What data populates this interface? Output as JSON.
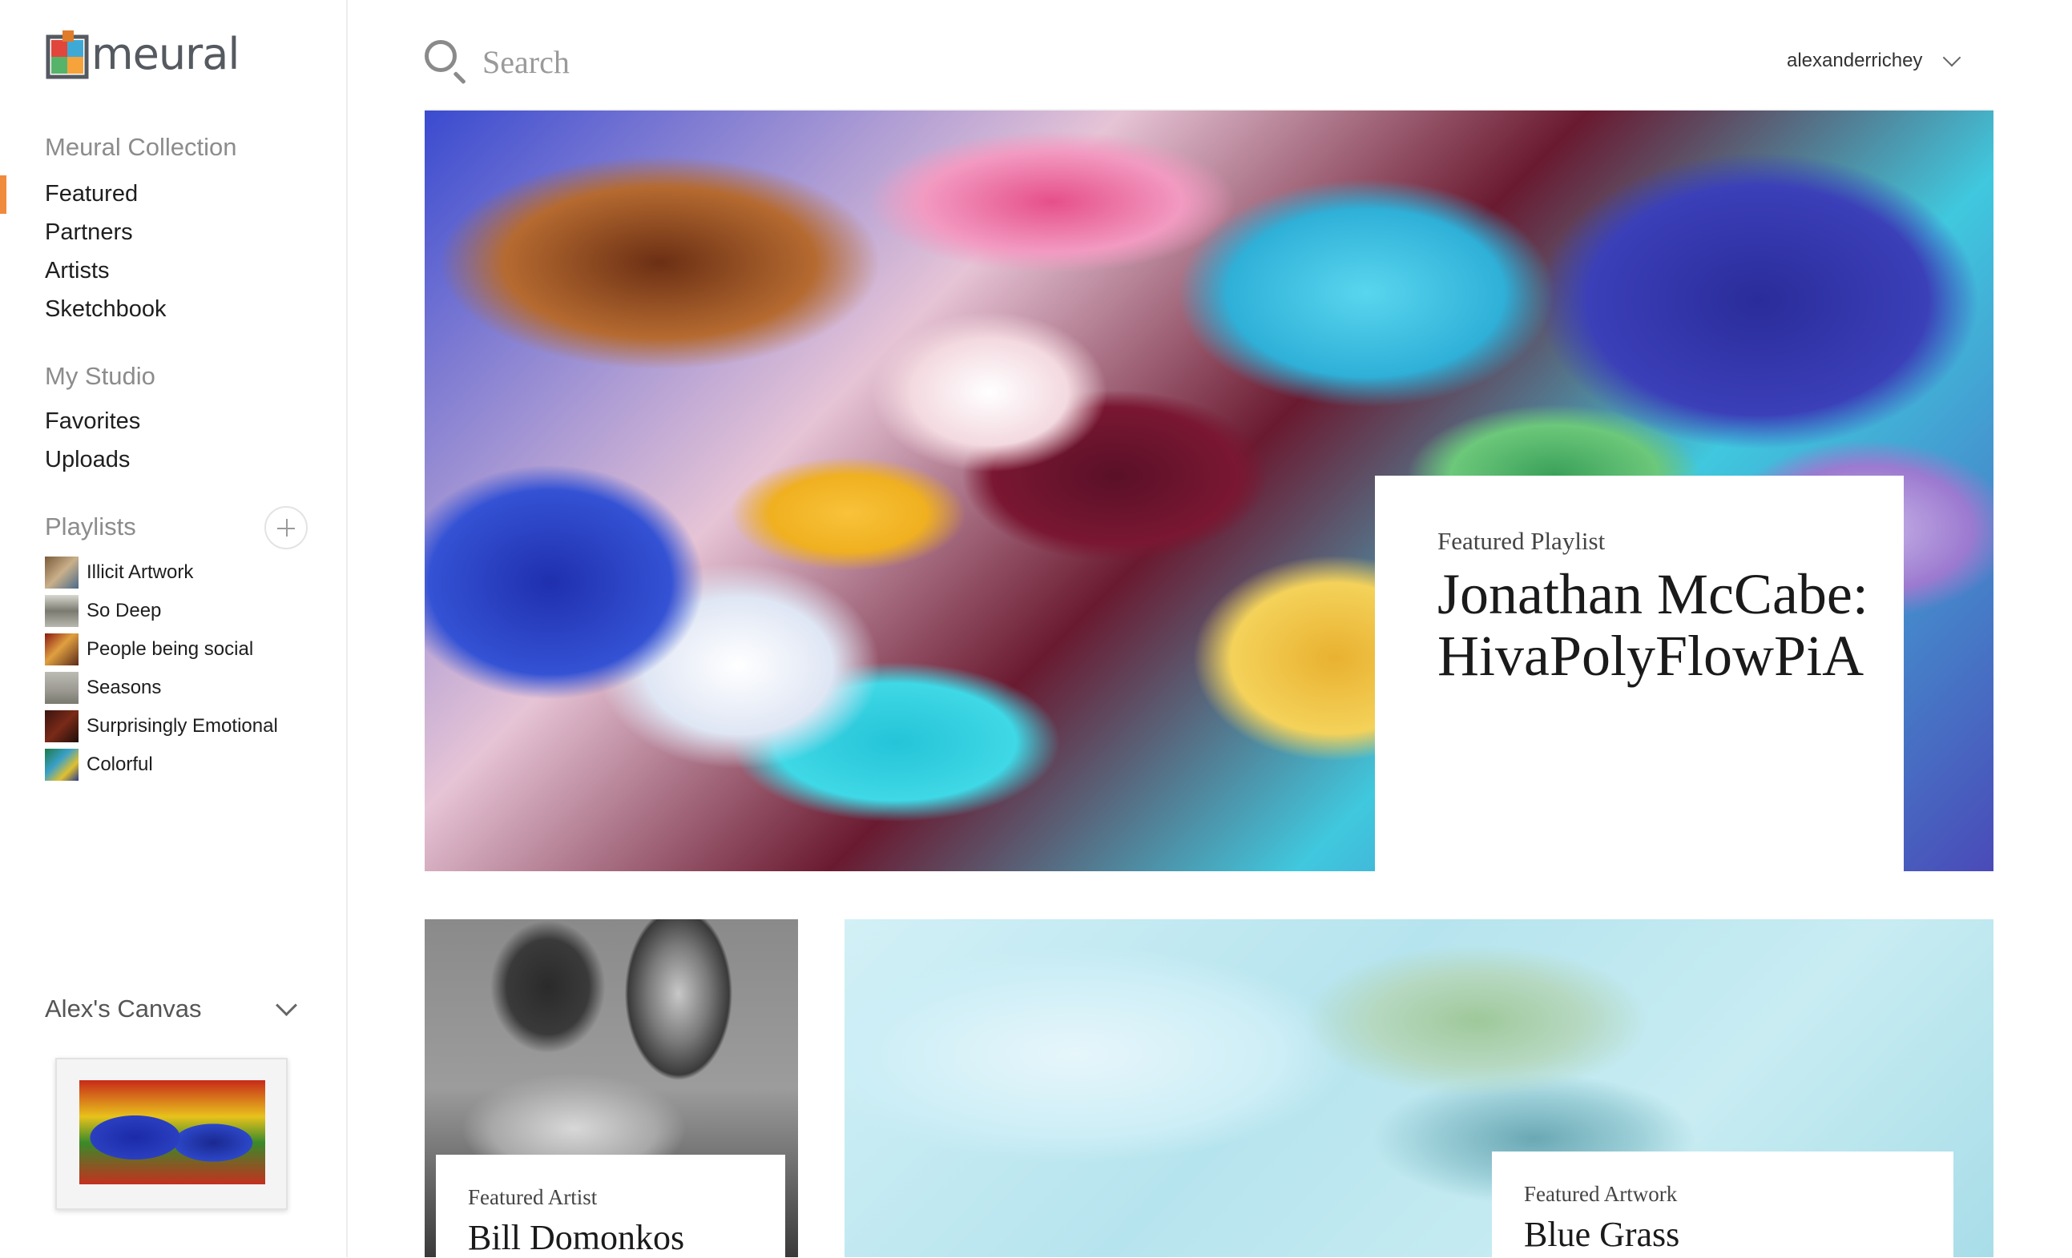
{
  "brand": {
    "name": "meural"
  },
  "sidebar": {
    "collection_title": "Meural Collection",
    "collection_items": [
      {
        "label": "Featured",
        "active": true
      },
      {
        "label": "Partners"
      },
      {
        "label": "Artists"
      },
      {
        "label": "Sketchbook"
      }
    ],
    "studio_title": "My Studio",
    "studio_items": [
      {
        "label": "Favorites"
      },
      {
        "label": "Uploads"
      }
    ],
    "playlists_title": "Playlists",
    "playlists": [
      {
        "label": "Illicit Artwork"
      },
      {
        "label": "So Deep"
      },
      {
        "label": "People being social"
      },
      {
        "label": "Seasons"
      },
      {
        "label": "Surprisingly Emotional"
      },
      {
        "label": "Colorful"
      }
    ],
    "canvas_title": "Alex's Canvas"
  },
  "header": {
    "search_placeholder": "Search",
    "username": "alexanderrichey"
  },
  "hero": {
    "kicker": "Featured Playlist",
    "title": "Jonathan McCabe: HivaPolyFlowPiA"
  },
  "featured_artist": {
    "kicker": "Featured Artist",
    "name": "Bill Domonkos"
  },
  "featured_artwork": {
    "kicker": "Featured Artwork",
    "name": "Blue Grass"
  },
  "colors": {
    "accent": "#f08a3c"
  }
}
